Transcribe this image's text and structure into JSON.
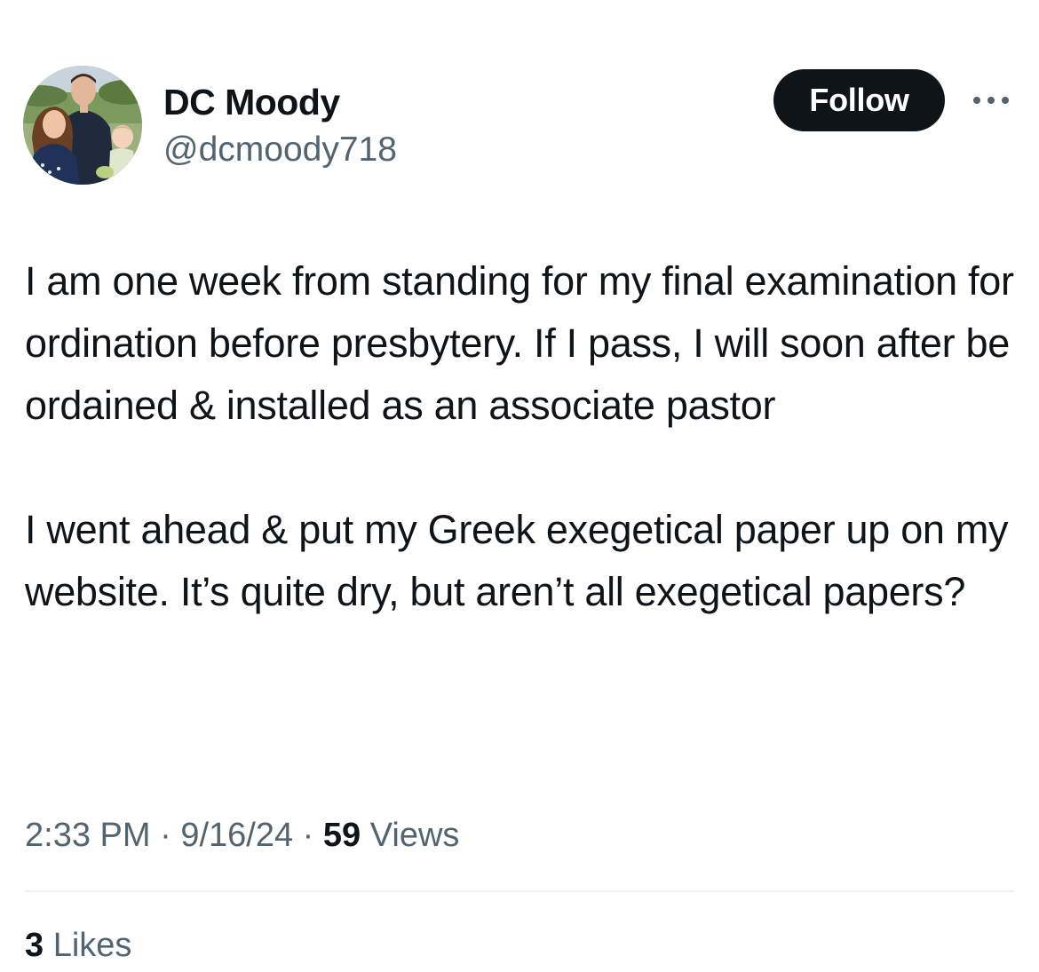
{
  "author": {
    "display_name": "DC Moody",
    "handle": "@dcmoody718",
    "avatar_icon": "family-photo-avatar"
  },
  "actions": {
    "follow_label": "Follow",
    "more_icon": "more-dots-icon"
  },
  "tweet": {
    "paragraphs": [
      "I am one week from standing for my final examination for ordination before presbytery. If I pass, I will soon after be ordained & installed as an associate pastor",
      "I went ahead & put my Greek exegetical paper up on my website. It’s quite dry, but aren’t all exegetical papers?"
    ]
  },
  "meta": {
    "time": "2:33 PM",
    "separator": " · ",
    "date": "9/16/24",
    "views_count": "59",
    "views_label": "Views"
  },
  "engagement": {
    "likes_count": "3",
    "likes_label": "Likes"
  },
  "colors": {
    "primary_text": "#0f1419",
    "secondary_text": "#536471",
    "follow_button_bg": "#0f1419",
    "divider": "#eff3f4"
  }
}
